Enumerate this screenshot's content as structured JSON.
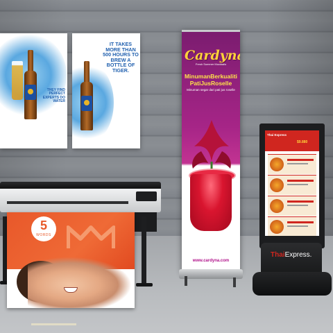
{
  "scene": {
    "description_colors": {
      "wall": "#8a8e93",
      "floor": "#b9bcbf",
      "banner_primary": "#a62587",
      "banner_accent": "#ffd23a",
      "sheet_accent": "#ef6a36",
      "sign_accent": "#d0261f"
    }
  },
  "posters": [
    {
      "text": "THEY FIND PERFECT EXPERTS DO WATER"
    },
    {
      "text": "IT TAKES MORE THAN 500 HOURS TO BREW A BOTTLE OF TIGER."
    }
  ],
  "printed_sheet": {
    "badge_number": "5",
    "badge_label": "WORDS"
  },
  "rollup_banner": {
    "brand": "Cardyna",
    "brand_sub": "Fresh Summer Mocktails",
    "headline": "MinumanBerkualiti PatiJusRoselle",
    "subline": "Minuman segar dari pati jus roselle",
    "website": "www.cardyna.com"
  },
  "menu_sign": {
    "screen_title": "Thai Express",
    "screen_price": "$9.880",
    "brand_prefix": "Thai",
    "brand_suffix": "Express."
  }
}
